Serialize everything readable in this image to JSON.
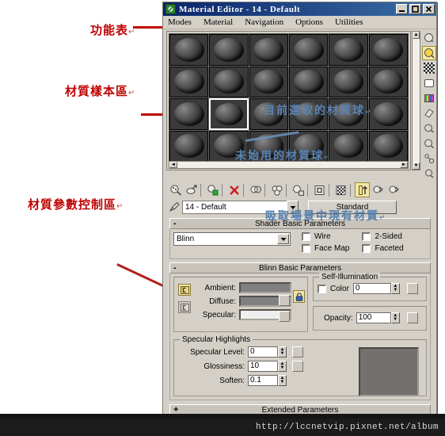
{
  "window": {
    "title": "Material Editor - 14 - Default",
    "icon": "material-editor-icon",
    "buttons": {
      "minimize": "_",
      "maximize": "□",
      "close": "✕"
    }
  },
  "menu": {
    "items": [
      {
        "label": "Modes"
      },
      {
        "label": "Material"
      },
      {
        "label": "Navigation"
      },
      {
        "label": "Options"
      },
      {
        "label": "Utilities"
      }
    ]
  },
  "sample_slots": {
    "rows": 4,
    "columns": 6,
    "selected_index": 13,
    "count": 24
  },
  "vertical_toolbar": {
    "items": [
      {
        "icon": "sample-type-sphere-icon",
        "active": false
      },
      {
        "icon": "backlight-icon",
        "active": true
      },
      {
        "icon": "background-checker-icon",
        "active": false
      },
      {
        "icon": "sample-uv-tiling-icon",
        "active": false
      },
      {
        "icon": "video-color-check-icon",
        "active": false
      },
      {
        "icon": "make-preview-icon",
        "active": false
      },
      {
        "icon": "options-icon",
        "active": false
      },
      {
        "icon": "select-by-material-icon",
        "active": false
      },
      {
        "icon": "material-map-navigator-icon",
        "active": false
      }
    ]
  },
  "horizontal_toolbar": {
    "items": [
      {
        "icon": "get-material-icon",
        "active": false
      },
      {
        "icon": "put-material-to-scene-icon",
        "active": false
      },
      {
        "icon": "assign-material-to-selection-icon",
        "active": false
      },
      {
        "icon": "reset-map-material-icon",
        "active": false
      },
      {
        "icon": "make-material-copy-icon",
        "active": false
      },
      {
        "icon": "make-unique-icon",
        "active": false
      },
      {
        "icon": "put-to-library-icon",
        "active": false
      },
      {
        "icon": "material-effects-channel-icon",
        "active": false
      },
      {
        "icon": "show-map-in-viewport-icon",
        "active": false
      },
      {
        "icon": "show-end-result-icon",
        "active": true
      },
      {
        "icon": "go-to-parent-icon",
        "active": false
      },
      {
        "icon": "go-forward-to-sibling-icon",
        "active": false
      }
    ]
  },
  "material_name": {
    "eyedropper_icon": "pick-material-from-object-icon",
    "value": "14 - Default",
    "dropdown_icon": "chevron-down-icon",
    "type_button": "Standard"
  },
  "shader_basic": {
    "title": "Shader Basic Parameters",
    "collapse_mark": "-",
    "shader": "Blinn",
    "checkboxes": [
      {
        "label": "Wire",
        "checked": false
      },
      {
        "label": "2-Sided",
        "checked": false
      },
      {
        "label": "Face Map",
        "checked": false
      },
      {
        "label": "Faceted",
        "checked": false
      }
    ]
  },
  "blinn_basic": {
    "title": "Blinn Basic Parameters",
    "collapse_mark": "-",
    "colors": [
      {
        "label": "Ambient:",
        "value": "#808080"
      },
      {
        "label": "Diffuse:",
        "value": "#808080"
      },
      {
        "label": "Specular:",
        "value": "#efefef"
      }
    ],
    "lock_icon": "lock-ambient-diffuse-icon",
    "self_illumination": {
      "title": "Self-Illumination",
      "color_label": "Color",
      "color_checked": false,
      "value": "0"
    },
    "opacity": {
      "label": "Opacity:",
      "value": "100"
    },
    "specular_highlights": {
      "title": "Specular Highlights",
      "fields": [
        {
          "label": "Specular Level:",
          "value": "0"
        },
        {
          "label": "Glossiness:",
          "value": "10"
        },
        {
          "label": "Soften:",
          "value": "0.1"
        }
      ]
    }
  },
  "extended": {
    "title": "Extended Parameters",
    "collapse_mark": "+"
  },
  "annotations": {
    "red": [
      {
        "text": "功能表",
        "mark": "↵"
      },
      {
        "text": "材質樣本區",
        "mark": "↵"
      },
      {
        "text": "材質參數控制區",
        "mark": "↵"
      }
    ],
    "blue": [
      {
        "text": "目前選取的材質球",
        "mark": "↵"
      },
      {
        "text": "未始用的材質球",
        "mark": "↵"
      },
      {
        "text": "吸取場景中現有材質",
        "mark": "↵"
      }
    ]
  },
  "footer": {
    "url": "http://lccnetvip.pixnet.net/album"
  },
  "colors": {
    "annotation_red": "#c00000",
    "annotation_blue": "#5b84b1",
    "window_face": "#d4d0c8",
    "titlebar": "#0a246a",
    "highlight_yellow": "#f5e7a8"
  }
}
